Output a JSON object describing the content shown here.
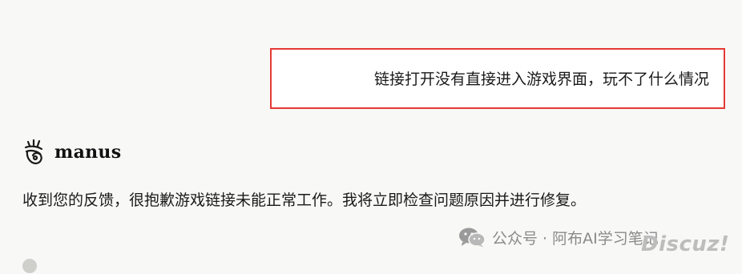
{
  "user_message": {
    "text": "链接打开没有直接进入游戏界面，玩不了什么情况"
  },
  "assistant": {
    "name": "manus",
    "icon": "manus-logo-icon",
    "message": "收到您的反馈，很抱歉游戏链接未能正常工作。我将立即检查问题原因并进行修复。"
  },
  "watermark": {
    "icon": "wechat-icon",
    "text": "公众号 · 阿布AI学习笔记",
    "discuz": "Discuz!"
  },
  "colors": {
    "highlight_border": "#e53935",
    "background": "#f8f8f7",
    "bubble_bg": "#ffffff"
  }
}
